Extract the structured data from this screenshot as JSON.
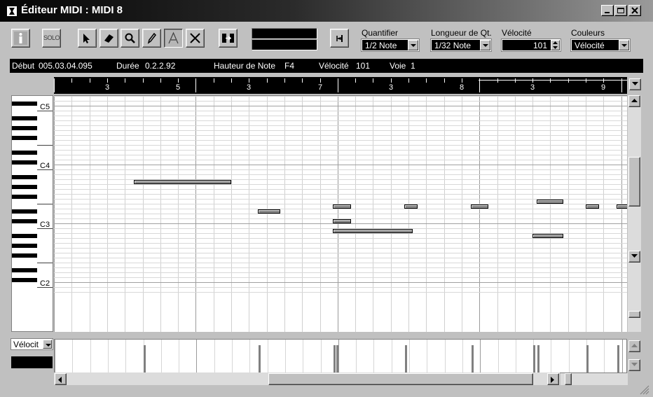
{
  "window": {
    "title": "Éditeur MIDI : MIDI 8"
  },
  "icons": {
    "title": "midi-editor-icon",
    "info": "info-icon",
    "solo": "solo-icon",
    "arrow": "arrow-tool-icon",
    "eraser": "eraser-tool-icon",
    "magnifier": "magnifier-tool-icon",
    "pencil": "pencil-tool-icon",
    "line": "line-tool-icon",
    "mute": "mute-tool-icon",
    "autoscroll": "autoscroll-icon",
    "snap": "snap-icon"
  },
  "toolbar": {
    "solo_label": "SOLO",
    "quantize_label": "Quantifier",
    "quantize_value": "1/2 Note",
    "qlength_label": "Longueur de Qt.",
    "qlength_value": "1/32 Note",
    "velocity_label": "Vélocité",
    "velocity_value": "101",
    "colors_label": "Couleurs",
    "colors_value": "Vélocité"
  },
  "info": {
    "start_label": "Début",
    "start_value": "005.03.04.095",
    "duration_label": "Durée",
    "duration_value": "0.2.2.92",
    "pitch_label": "Hauteur de Note",
    "pitch_value": "F4",
    "velocity_label": "Vélocité",
    "velocity_value": "101",
    "channel_label": "Voie",
    "channel_value": "1"
  },
  "ruler": {
    "labels": [
      "3",
      "5",
      "3",
      "7",
      "3",
      "8",
      "3",
      "9"
    ]
  },
  "keyboard": {
    "labels": [
      "C5",
      "C4",
      "C3",
      "C2"
    ]
  },
  "controller": {
    "lane_value": "Vélocit"
  },
  "notes": [
    {
      "pitch": "A4",
      "start_beat": 4.5,
      "length_beats": 5.5
    },
    {
      "pitch": "D#4",
      "start_beat": 11.5,
      "length_beats": 1.25
    },
    {
      "pitch": "E4",
      "start_beat": 15.75,
      "length_beats": 1.0
    },
    {
      "pitch": "E4",
      "start_beat": 19.75,
      "length_beats": 0.75
    },
    {
      "pitch": "E4",
      "start_beat": 23.5,
      "length_beats": 1.0
    },
    {
      "pitch": "F4",
      "start_beat": 27.25,
      "length_beats": 1.5
    },
    {
      "pitch": "E4",
      "start_beat": 30.0,
      "length_beats": 0.75
    },
    {
      "pitch": "E4",
      "start_beat": 31.75,
      "length_beats": 0.75
    },
    {
      "pitch": "C#4",
      "start_beat": 15.75,
      "length_beats": 1.0
    },
    {
      "pitch": "B3",
      "start_beat": 15.75,
      "length_beats": 4.5
    },
    {
      "pitch": "A#3",
      "start_beat": 27.0,
      "length_beats": 1.75
    }
  ],
  "velocities": [
    {
      "beat": 5.0,
      "value": 101
    },
    {
      "beat": 11.5,
      "value": 101
    },
    {
      "beat": 15.75,
      "value": 101
    },
    {
      "beat": 15.9,
      "value": 101
    },
    {
      "beat": 19.75,
      "value": 101
    },
    {
      "beat": 23.5,
      "value": 101
    },
    {
      "beat": 27.0,
      "value": 101
    },
    {
      "beat": 27.25,
      "value": 101
    },
    {
      "beat": 30.0,
      "value": 101
    },
    {
      "beat": 31.75,
      "value": 101
    }
  ]
}
